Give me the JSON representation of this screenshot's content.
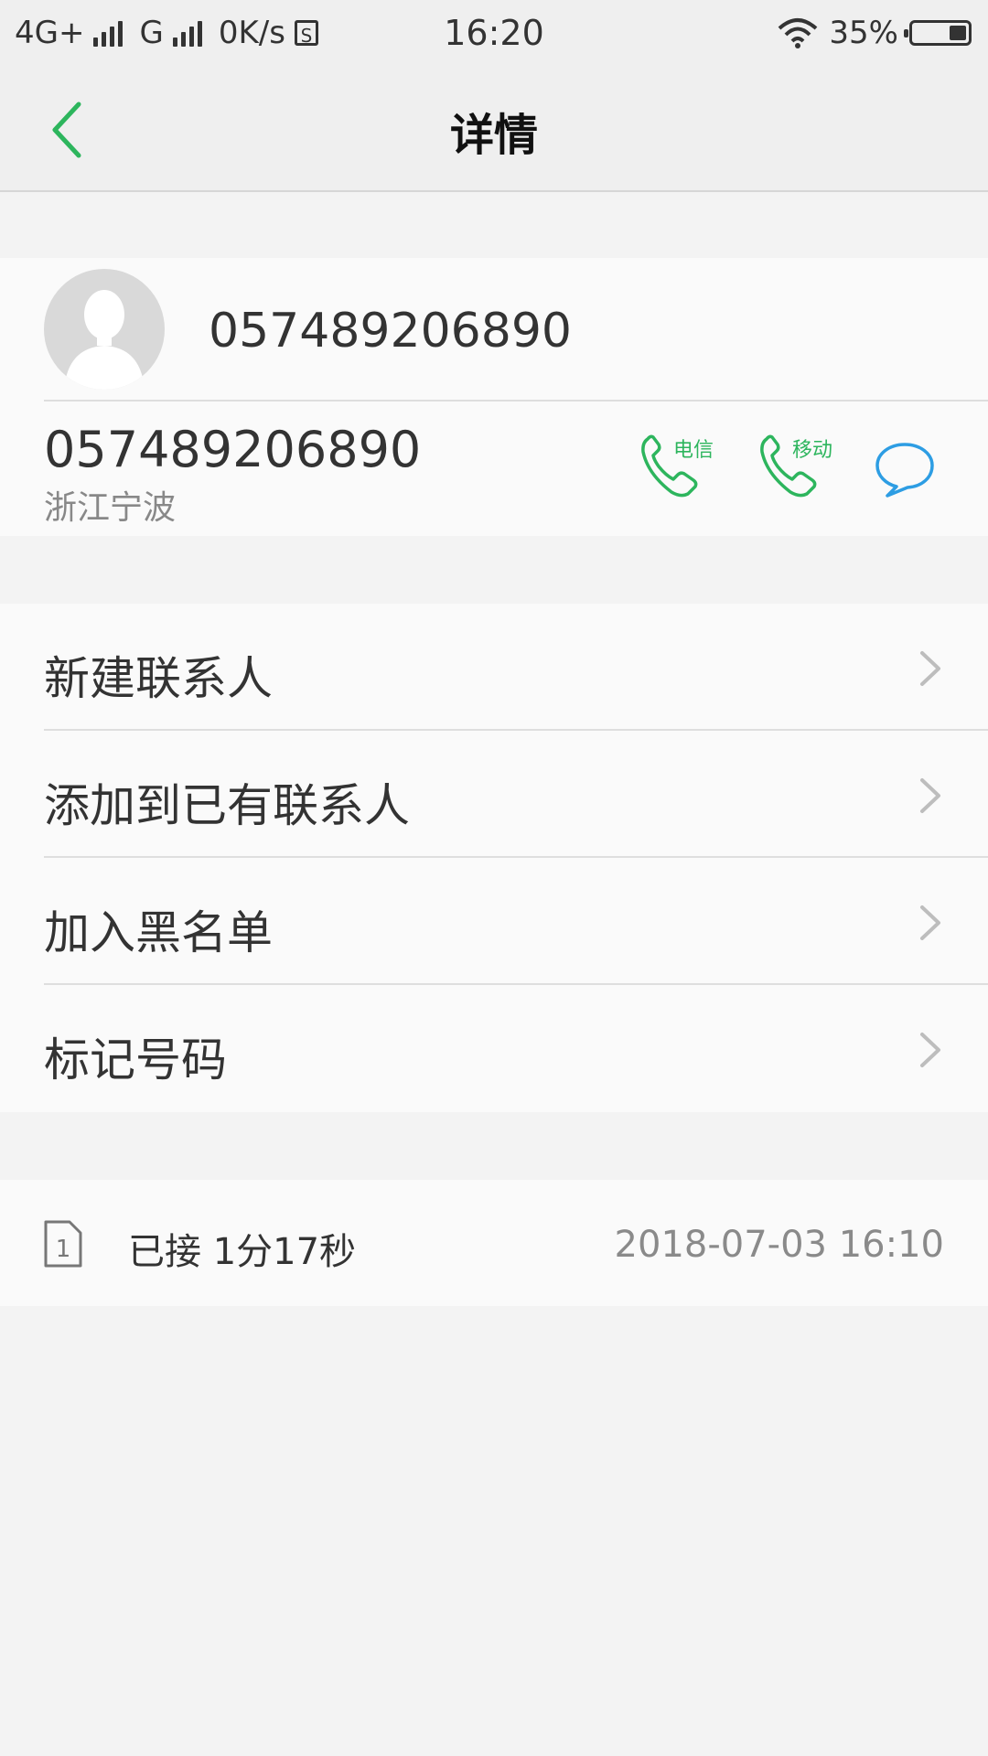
{
  "status_bar": {
    "network1": "4G+",
    "network2": "G",
    "speed": "0K/s",
    "sim_badge": "S",
    "time": "16:20",
    "battery": "35%"
  },
  "nav": {
    "title": "详情"
  },
  "contact": {
    "name": "057489206890",
    "number": "057489206890",
    "location": "浙江宁波",
    "call_label_1": "电信",
    "call_label_2": "移动"
  },
  "menu": {
    "items": [
      {
        "label": "新建联系人"
      },
      {
        "label": "添加到已有联系人"
      },
      {
        "label": "加入黑名单"
      },
      {
        "label": "标记号码"
      }
    ]
  },
  "call_log": {
    "sim": "1",
    "status": "已接 1分17秒",
    "datetime": "2018-07-03 16:10"
  },
  "colors": {
    "accent_green": "#2db55d",
    "message_blue": "#2d9de3"
  }
}
